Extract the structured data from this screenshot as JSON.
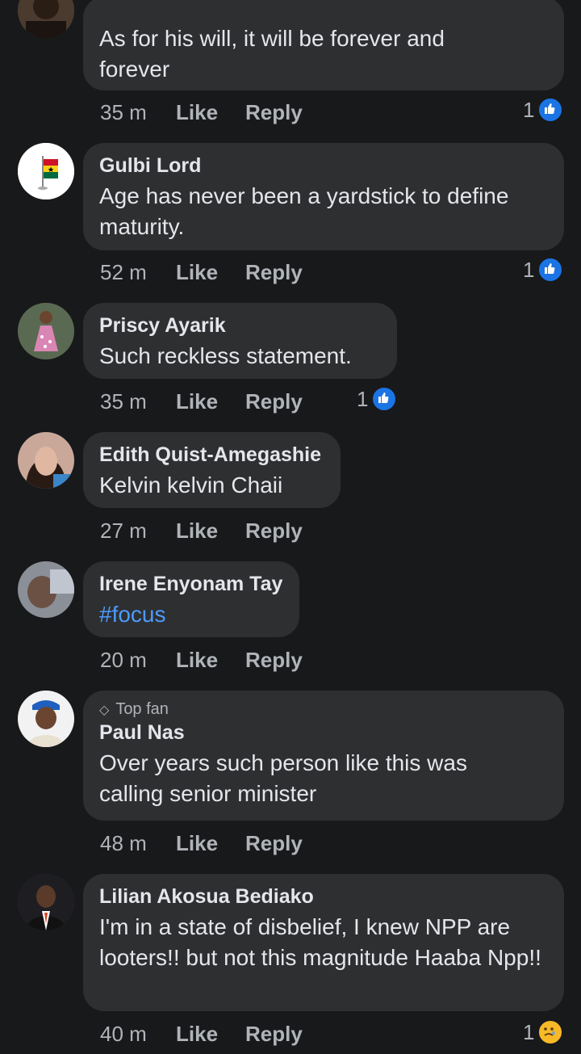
{
  "comments": [
    {
      "author": "",
      "text": "As for his will, it will be forever and forever",
      "time": "35 m",
      "like": "Like",
      "reply": "Reply",
      "reaction_count": "1",
      "reaction": "like-icon"
    },
    {
      "author": "Gulbi Lord",
      "text": "Age has never been a yardstick to define maturity.",
      "time": "52 m",
      "like": "Like",
      "reply": "Reply",
      "reaction_count": "1",
      "reaction": "like-icon"
    },
    {
      "author": "Priscy Ayarik",
      "text": "Such reckless statement.",
      "time": "35 m",
      "like": "Like",
      "reply": "Reply",
      "reaction_count": "1",
      "reaction": "like-icon"
    },
    {
      "author": "Edith Quist-Amegashie",
      "text": "Kelvin kelvin Chaii",
      "time": "27 m",
      "like": "Like",
      "reply": "Reply"
    },
    {
      "author": "Irene Enyonam Tay",
      "text": "#focus",
      "time": "20 m",
      "like": "Like",
      "reply": "Reply"
    },
    {
      "badge": "Top fan",
      "author": "Paul Nas",
      "text": "Over years such person like this was calling senior minister",
      "time": "48 m",
      "like": "Like",
      "reply": "Reply"
    },
    {
      "author": "Lilian Akosua Bediako",
      "text": "I'm in a state of disbelief, I knew NPP are looters!! but not this magnitude Haaba Npp!!",
      "time": "40 m",
      "like": "Like",
      "reply": "Reply",
      "reaction_count": "1",
      "reaction": "sad-icon"
    }
  ],
  "colors": {
    "background": "#18191b",
    "bubble": "#2e2f31",
    "link": "#4c9bff",
    "like_blue": "#1b74e4",
    "sad_yellow": "#f7b928"
  }
}
